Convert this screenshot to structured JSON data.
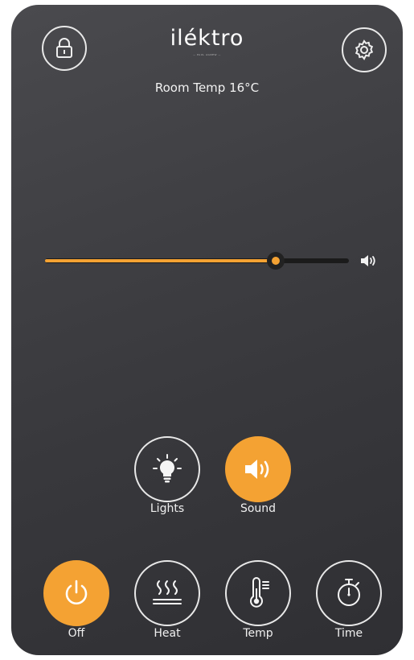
{
  "header": {
    "brand": "iléktro",
    "brand_sub": "— PAUL AGNEW —",
    "lock_icon": "lock-icon",
    "settings_icon": "gear-icon"
  },
  "status": {
    "room_temp": "Room Temp 16°C"
  },
  "volume": {
    "level": 0.76,
    "icon": "speaker-icon"
  },
  "toggles": [
    {
      "label": "Lights",
      "icon": "light-bulb-icon",
      "active": false
    },
    {
      "label": "Sound",
      "icon": "speaker-icon",
      "active": true
    }
  ],
  "controls": [
    {
      "label": "Off",
      "icon": "power-icon",
      "active": true
    },
    {
      "label": "Heat",
      "icon": "heat-icon",
      "active": false
    },
    {
      "label": "Temp",
      "icon": "thermometer-icon",
      "active": false
    },
    {
      "label": "Time",
      "icon": "timer-icon",
      "active": false
    }
  ],
  "colors": {
    "accent": "#f4a233",
    "background": "#3f3f43",
    "outline": "#e8e8e8"
  }
}
